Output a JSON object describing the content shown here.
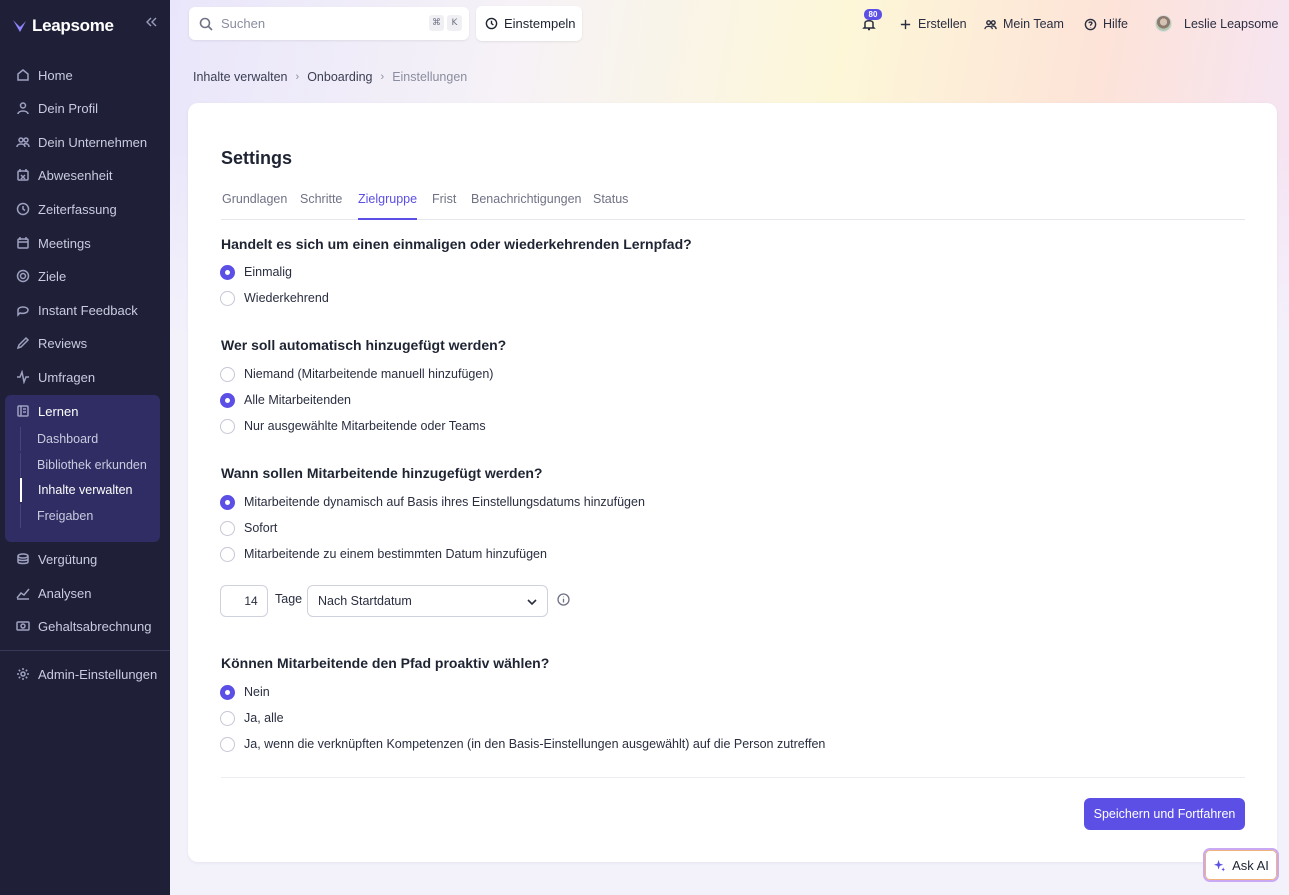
{
  "brand": {
    "name": "Leapsome"
  },
  "sidebar": {
    "items": [
      {
        "label": "Home",
        "icon": "home-icon"
      },
      {
        "label": "Dein Profil",
        "icon": "user-icon"
      },
      {
        "label": "Dein Unternehmen",
        "icon": "users-icon"
      },
      {
        "label": "Abwesenheit",
        "icon": "calendar-x-icon"
      },
      {
        "label": "Zeiterfassung",
        "icon": "clock-icon"
      },
      {
        "label": "Meetings",
        "icon": "calendar-icon"
      },
      {
        "label": "Ziele",
        "icon": "target-icon"
      },
      {
        "label": "Instant Feedback",
        "icon": "chat-icon"
      },
      {
        "label": "Reviews",
        "icon": "pencil-icon"
      },
      {
        "label": "Umfragen",
        "icon": "pulse-icon"
      },
      {
        "label": "Lernen",
        "icon": "book-icon"
      },
      {
        "label": "Vergütung",
        "icon": "coins-icon"
      },
      {
        "label": "Analysen",
        "icon": "chart-icon"
      },
      {
        "label": "Gehaltsabrechnung",
        "icon": "money-icon"
      },
      {
        "label": "Admin-Einstellungen",
        "icon": "gear-icon"
      }
    ],
    "learn_sub": [
      {
        "label": "Dashboard"
      },
      {
        "label": "Bibliothek erkunden"
      },
      {
        "label": "Inhalte verwalten"
      },
      {
        "label": "Freigaben"
      }
    ]
  },
  "topbar": {
    "search_placeholder": "Suchen",
    "kbd_cmd": "⌘",
    "kbd_k": "K",
    "clock_in": "Einstempeln",
    "notifications_count": "80",
    "create": "Erstellen",
    "my_team": "Mein Team",
    "help": "Hilfe",
    "user": "Leslie Leapsome"
  },
  "breadcrumb": [
    "Inhalte verwalten",
    "Onboarding",
    "Einstellungen"
  ],
  "main": {
    "title": "Settings",
    "tabs": [
      "Grundlagen",
      "Schritte",
      "Zielgruppe",
      "Frist",
      "Benachrichtigungen",
      "Status"
    ],
    "active_tab": "Zielgruppe",
    "questions": [
      {
        "title": "Handelt es sich um einen einmaligen oder wiederkehrenden Lernpfad?",
        "options": [
          "Einmalig",
          "Wiederkehrend"
        ],
        "selected": 0
      },
      {
        "title": "Wer soll automatisch hinzugefügt werden?",
        "options": [
          "Niemand (Mitarbeitende manuell hinzufügen)",
          "Alle Mitarbeitenden",
          "Nur ausgewählte Mitarbeitende oder Teams"
        ],
        "selected": 1
      },
      {
        "title": "Wann sollen Mitarbeitende hinzugefügt werden?",
        "options": [
          "Mitarbeitende dynamisch auf Basis ihres Einstellungsdatums hinzufügen",
          "Sofort",
          "Mitarbeitende zu einem bestimmten Datum hinzufügen"
        ],
        "selected": 0
      },
      {
        "title": "Können Mitarbeitende den Pfad proaktiv wählen?",
        "options": [
          "Nein",
          "Ja, alle",
          "Ja, wenn die verknüpften Kompetenzen (in den Basis-Einstellungen ausgewählt) auf die Person zutreffen"
        ],
        "selected": 0
      }
    ],
    "days_value": "14",
    "days_label": "Tage",
    "relative_to": "Nach Startdatum",
    "save_button": "Speichern und Fortfahren"
  },
  "ask_ai": "Ask AI",
  "colors": {
    "accent": "#5b4fe6",
    "sidebar": "#1f2038",
    "sidebar_active": "#2f2d63"
  }
}
